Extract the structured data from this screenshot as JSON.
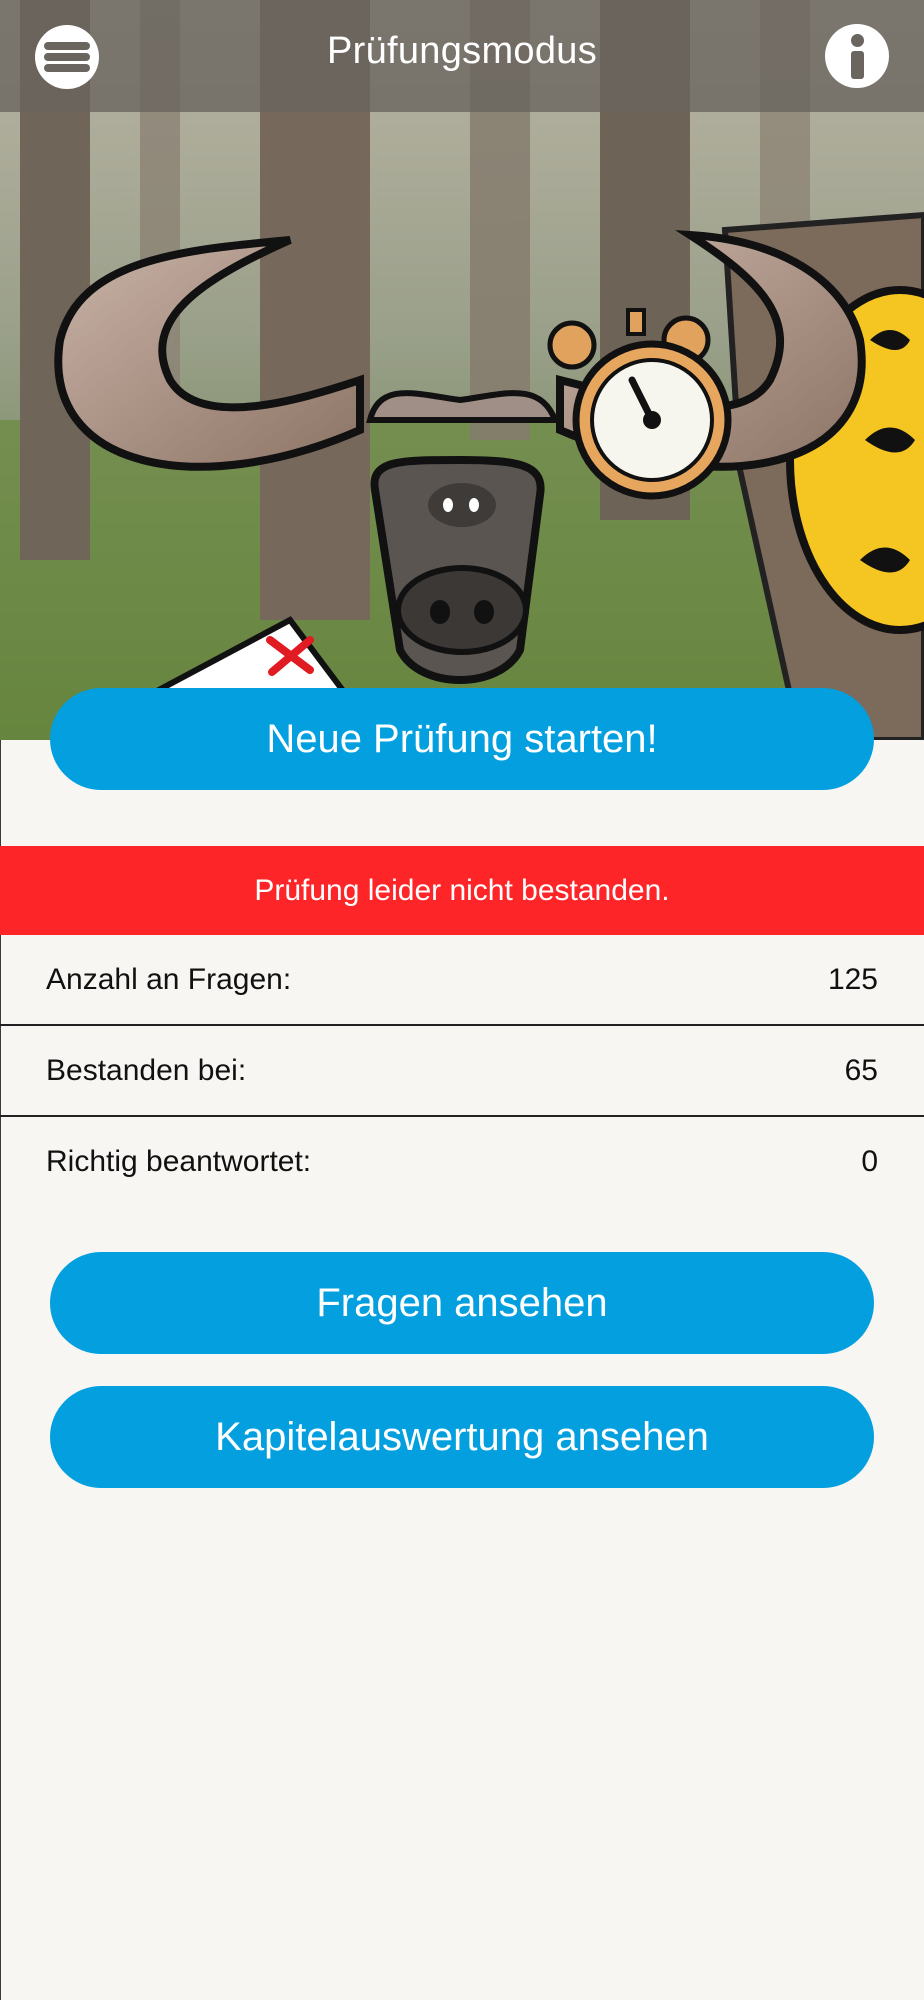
{
  "header": {
    "title": "Prüfungsmodus",
    "menu_icon": "hamburger-menu-icon",
    "info_icon": "info-icon"
  },
  "hero": {
    "image": "buffalo-with-stopwatch-illustration"
  },
  "actions": {
    "start_label": "Neue Prüfung starten!",
    "questions_label": "Fragen ansehen",
    "chapters_label": "Kapitelauswertung ansehen"
  },
  "result": {
    "message": "Prüfung leider nicht bestanden.",
    "status_color": "#fd2527"
  },
  "stats": [
    {
      "label": "Anzahl an Fragen:",
      "value": "125"
    },
    {
      "label": "Bestanden bei:",
      "value": "65"
    },
    {
      "label": "Richtig beantwortet:",
      "value": "0"
    }
  ],
  "colors": {
    "accent": "#039fdf",
    "background": "#f7f6f3"
  }
}
